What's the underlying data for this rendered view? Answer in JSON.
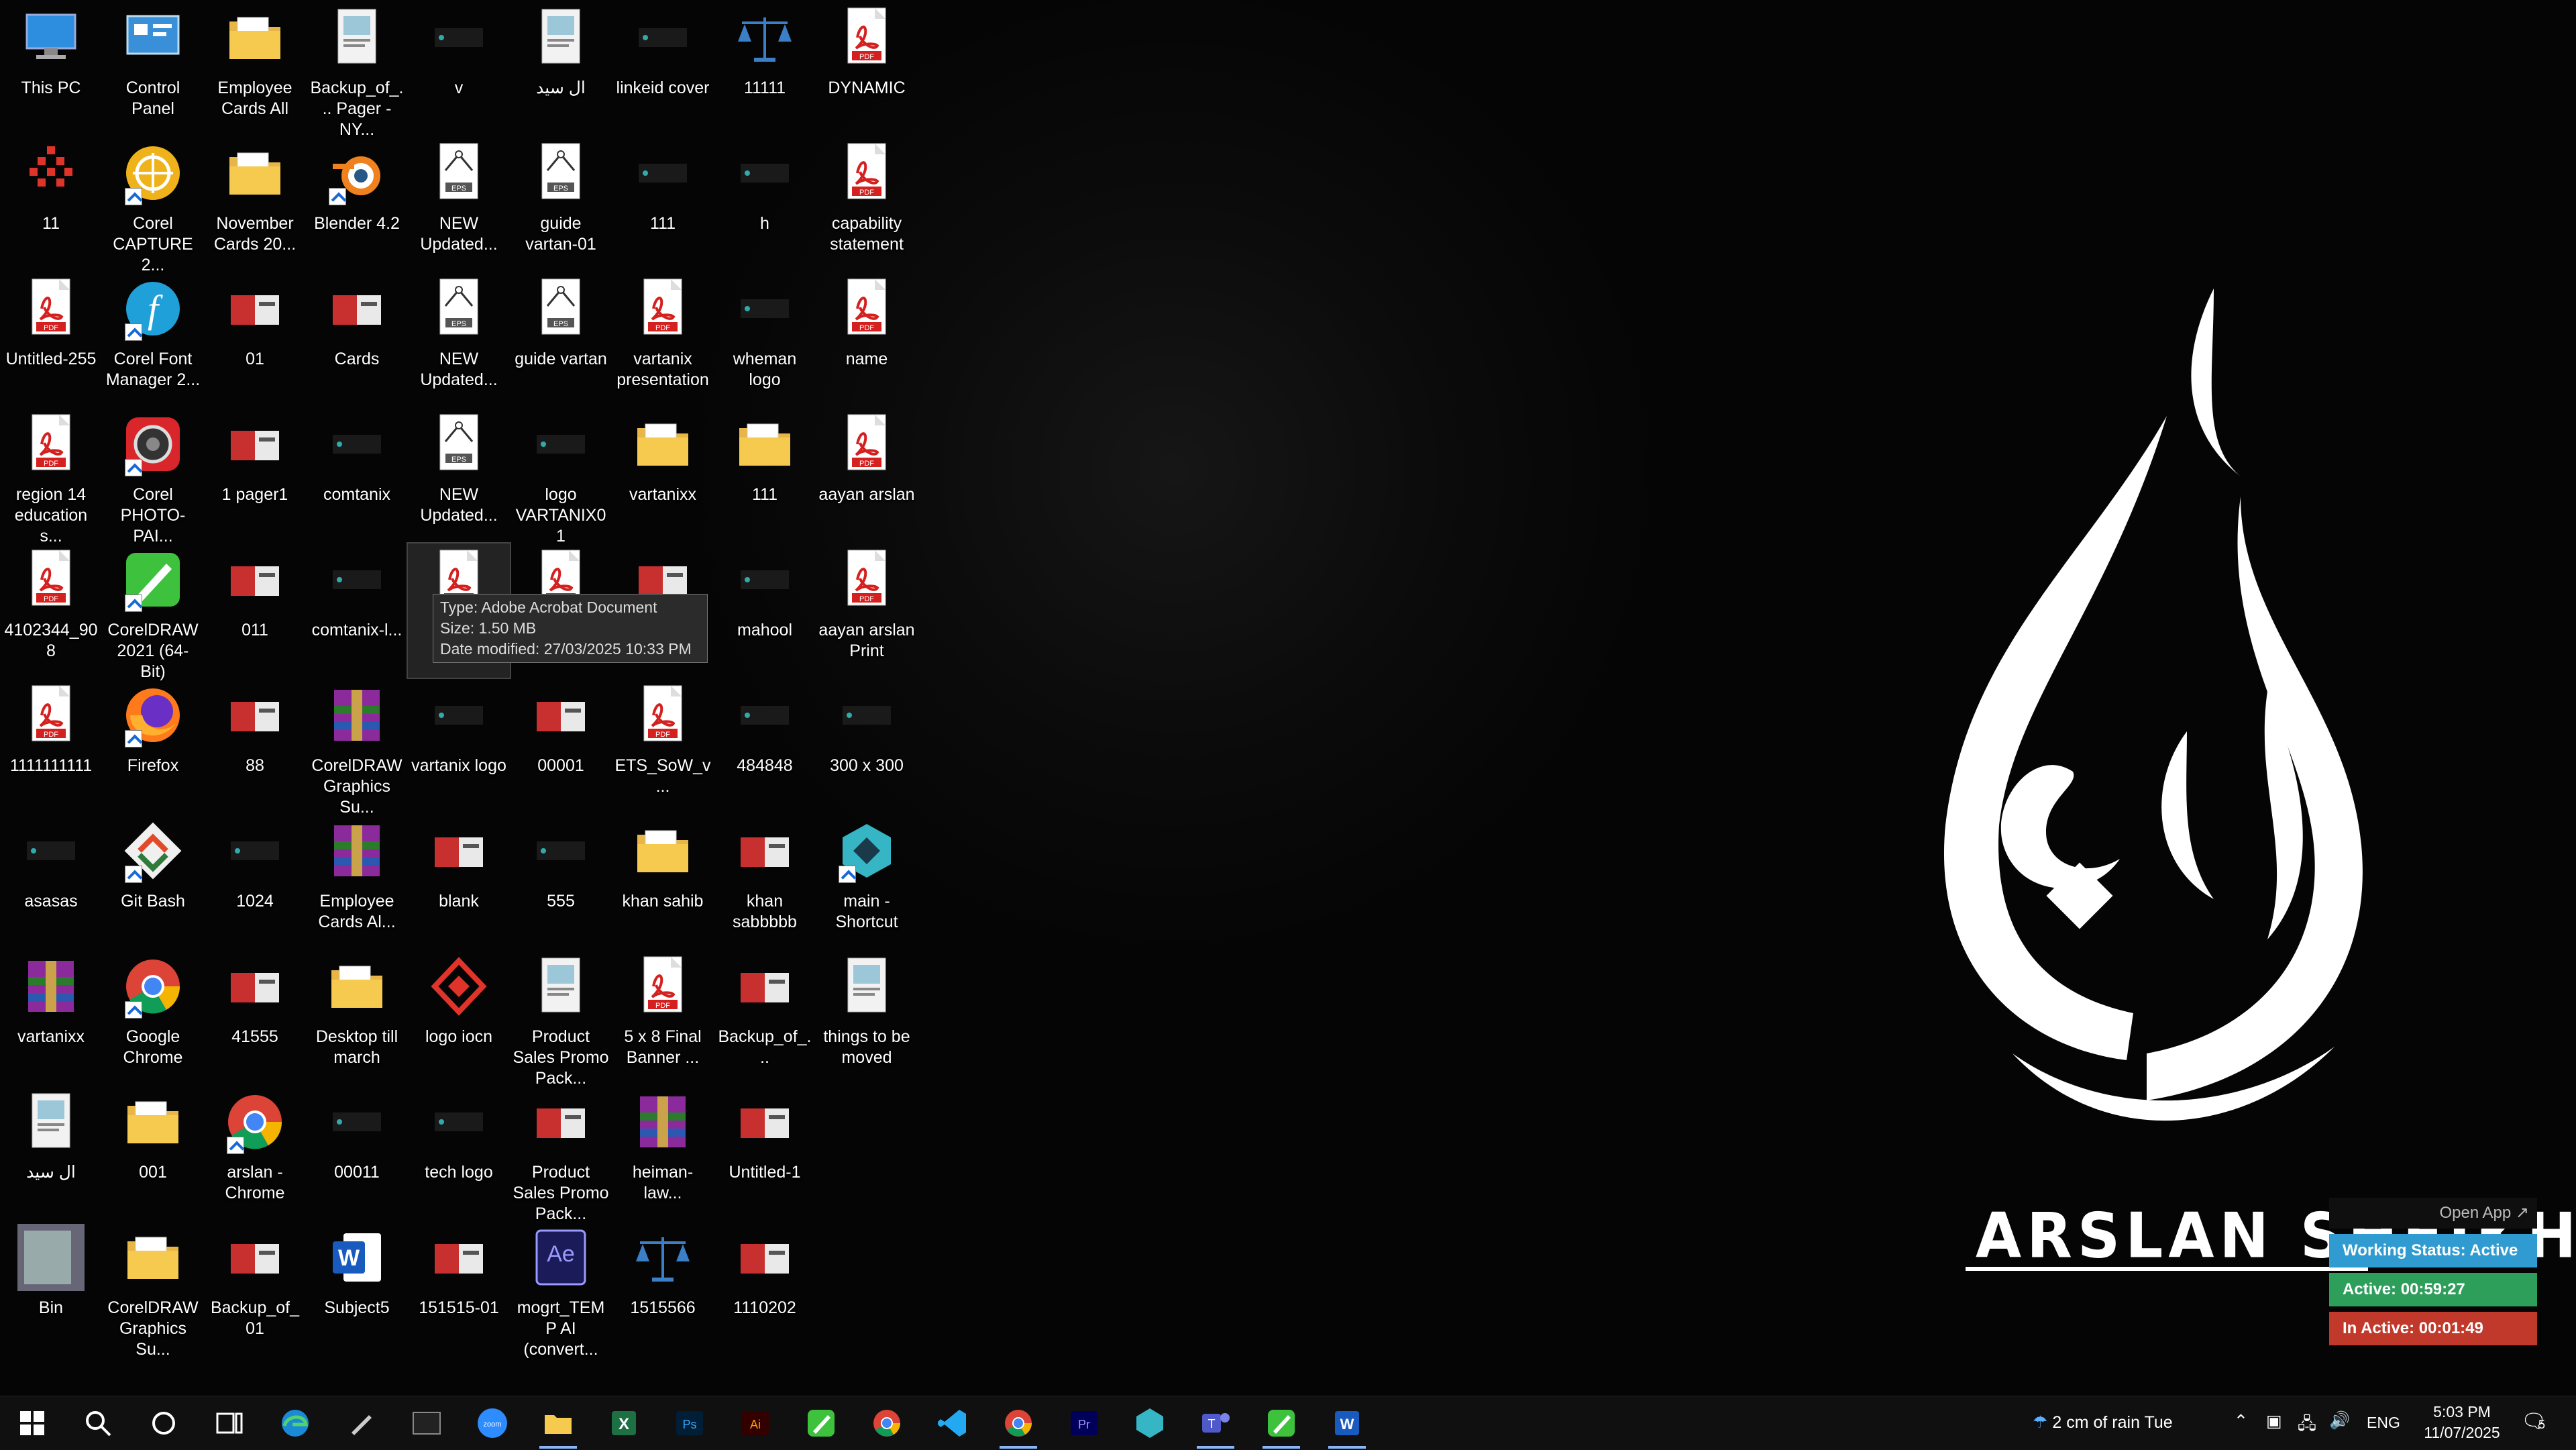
{
  "icons": [
    {
      "label": "This PC",
      "type": "pc"
    },
    {
      "label": "11",
      "type": "dots"
    },
    {
      "label": "Untitled-255",
      "type": "pdf"
    },
    {
      "label": "region 14 education s...",
      "type": "pdf"
    },
    {
      "label": "4102344_908",
      "type": "pdf"
    },
    {
      "label": "1111111111",
      "type": "pdf"
    },
    {
      "label": "asasas",
      "type": "dark"
    },
    {
      "label": "vartanixx",
      "type": "rar"
    },
    {
      "label": "ال سيد",
      "type": "doc"
    },
    {
      "label": "Bin",
      "type": "bin"
    },
    {
      "label": "Control Panel",
      "type": "cpanel"
    },
    {
      "label": "Corel CAPTURE 2...",
      "type": "corelcap"
    },
    {
      "label": "Corel Font Manager 2...",
      "type": "corelfont"
    },
    {
      "label": "Corel PHOTO-PAI...",
      "type": "corelphoto"
    },
    {
      "label": "CorelDRAW 2021 (64-Bit)",
      "type": "cdr"
    },
    {
      "label": "Firefox",
      "type": "firefox"
    },
    {
      "label": "Git Bash",
      "type": "git"
    },
    {
      "label": "Google Chrome",
      "type": "chrome"
    },
    {
      "label": "001",
      "type": "folder"
    },
    {
      "label": "CorelDRAW Graphics Su...",
      "type": "folder"
    },
    {
      "label": "Employee Cards All",
      "type": "folder"
    },
    {
      "label": "November Cards 20...",
      "type": "folder"
    },
    {
      "label": "01",
      "type": "thumb"
    },
    {
      "label": "1 pager1",
      "type": "thumb"
    },
    {
      "label": "011",
      "type": "thumb"
    },
    {
      "label": "88",
      "type": "thumb"
    },
    {
      "label": "1024",
      "type": "dark"
    },
    {
      "label": "41555",
      "type": "thumb"
    },
    {
      "label": "arslan - Chrome",
      "type": "chrome"
    },
    {
      "label": "Backup_of_01",
      "type": "thumb"
    },
    {
      "label": "Backup_of_... Pager - NY...",
      "type": "doc"
    },
    {
      "label": "Blender 4.2",
      "type": "blender"
    },
    {
      "label": "Cards",
      "type": "thumb"
    },
    {
      "label": "comtanix",
      "type": "dark"
    },
    {
      "label": "comtanix-l...",
      "type": "dark"
    },
    {
      "label": "CorelDRAW Graphics Su...",
      "type": "rar"
    },
    {
      "label": "Employee Cards Al...",
      "type": "rar"
    },
    {
      "label": "Desktop till march",
      "type": "folder"
    },
    {
      "label": "00011",
      "type": "dark"
    },
    {
      "label": "Subject5",
      "type": "word"
    },
    {
      "label": "v",
      "type": "dark"
    },
    {
      "label": "NEW Updated...",
      "type": "eps"
    },
    {
      "label": "NEW Updated...",
      "type": "eps"
    },
    {
      "label": "NEW Updated...",
      "type": "eps"
    },
    {
      "label": "v",
      "type": "pdf"
    },
    {
      "label": "vartanix logo",
      "type": "dark"
    },
    {
      "label": "blank",
      "type": "thumb"
    },
    {
      "label": "logo iocn",
      "type": "logoiocn"
    },
    {
      "label": "tech logo",
      "type": "dark"
    },
    {
      "label": "151515-01",
      "type": "thumb"
    },
    {
      "label": "ال سيد",
      "type": "doc"
    },
    {
      "label": "guide vartan-01",
      "type": "eps"
    },
    {
      "label": "guide vartan",
      "type": "eps"
    },
    {
      "label": "logo VARTANIX01",
      "type": "dark"
    },
    {
      "label": "",
      "type": "pdf"
    },
    {
      "label": "00001",
      "type": "thumb"
    },
    {
      "label": "555",
      "type": "dark"
    },
    {
      "label": "Product Sales Promo Pack...",
      "type": "doc"
    },
    {
      "label": "Product Sales Promo Pack...",
      "type": "thumb"
    },
    {
      "label": "mogrt_TEMP AI (convert...",
      "type": "ae"
    },
    {
      "label": "linkeid cover",
      "type": "dark"
    },
    {
      "label": "111",
      "type": "dark"
    },
    {
      "label": "vartanix presentation",
      "type": "pdf"
    },
    {
      "label": "vartanixx",
      "type": "folder"
    },
    {
      "label": "",
      "type": "thumb"
    },
    {
      "label": "ETS_SoW_v...",
      "type": "pdf"
    },
    {
      "label": "khan sahib",
      "type": "folder"
    },
    {
      "label": "5 x 8 Final Banner ...",
      "type": "pdf"
    },
    {
      "label": "heiman-law...",
      "type": "rar"
    },
    {
      "label": "1515566",
      "type": "scales"
    },
    {
      "label": "11111",
      "type": "scales"
    },
    {
      "label": "h",
      "type": "dark"
    },
    {
      "label": "wheman logo",
      "type": "dark"
    },
    {
      "label": "111",
      "type": "folder"
    },
    {
      "label": "mahool",
      "type": "dark"
    },
    {
      "label": "484848",
      "type": "dark"
    },
    {
      "label": "khan sabbbbb",
      "type": "thumb"
    },
    {
      "label": "Backup_of_...",
      "type": "thumb"
    },
    {
      "label": "Untitled-1",
      "type": "thumb"
    },
    {
      "label": "1110202",
      "type": "thumb"
    },
    {
      "label": "DYNAMIC",
      "type": "pdf"
    },
    {
      "label": "capability statement",
      "type": "pdf"
    },
    {
      "label": "name",
      "type": "pdf"
    },
    {
      "label": "aayan arslan",
      "type": "pdf"
    },
    {
      "label": "aayan arslan Print",
      "type": "pdf"
    },
    {
      "label": "300 x 300",
      "type": "dark"
    },
    {
      "label": "main - Shortcut",
      "type": "mainshortcut"
    },
    {
      "label": "things to be moved",
      "type": "doc"
    }
  ],
  "tooltip": {
    "type": "Type: Adobe Acrobat Document",
    "size": "Size: 1.50 MB",
    "modified": "Date modified: 27/03/2025 10:33 PM"
  },
  "wallpaper": {
    "brand_name": "ARSLAN SHEIKH"
  },
  "tracker": {
    "open_app": "Open App ↗",
    "status": "Working Status: Active",
    "active": "Active: 00:59:27",
    "inactive": "In Active: 00:01:49",
    "colors": {
      "status": "#2f9bd0",
      "active": "#2e9e5b",
      "inactive": "#c0392b"
    }
  },
  "taskbar": {
    "apps": [
      "start-icon",
      "search-icon",
      "cortana-icon",
      "task-view-icon",
      "edge-icon",
      "pen-icon",
      "terminal-icon",
      "zoom-icon",
      "file-explorer-icon",
      "excel-icon",
      "photoshop-icon",
      "illustrator-icon",
      "coreldraw-icon",
      "chrome-icon",
      "vscode-icon",
      "chrome-profile-icon",
      "premiere-icon",
      "app-icon",
      "teams-icon",
      "coreldraw-2-icon",
      "word-icon"
    ],
    "weather": "2 cm of rain Tue",
    "language": "ENG",
    "time": "5:03 PM",
    "date": "11/07/2025",
    "notifications": "5"
  }
}
